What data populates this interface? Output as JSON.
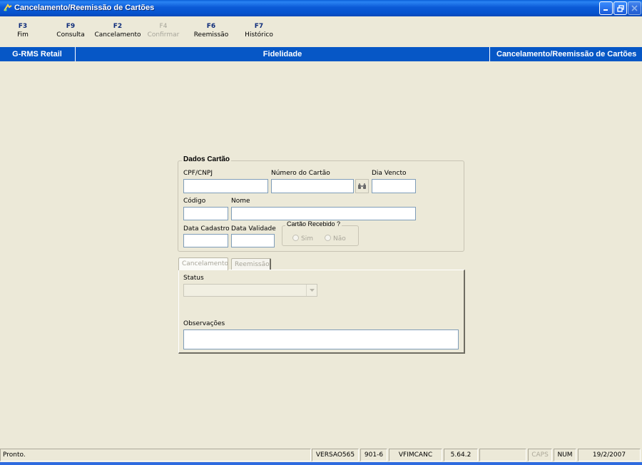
{
  "window": {
    "title": "Cancelamento/Reemissão de Cartões"
  },
  "fkeys": [
    {
      "key": "F3",
      "label": "Fim"
    },
    {
      "key": "F9",
      "label": "Consulta"
    },
    {
      "key": "F2",
      "label": "Cancelamento"
    },
    {
      "key": "F4",
      "label": "Confirmar"
    },
    {
      "key": "F6",
      "label": "Reemissão"
    },
    {
      "key": "F7",
      "label": "Histórico"
    }
  ],
  "band": {
    "left": "G-RMS Retail",
    "center": "Fidelidade",
    "right": "Cancelamento/Reemissão de Cartões"
  },
  "dados_cartao": {
    "title": "Dados Cartão",
    "cpf_label": "CPF/CNPJ",
    "cpf_value": "",
    "numero_label": "Número do Cartão",
    "numero_value": "",
    "dia_vencto_label": "Dia Vencto",
    "dia_vencto_value": "",
    "codigo_label": "Código",
    "codigo_value": "",
    "nome_label": "Nome",
    "nome_value": "",
    "data_cadastro_label": "Data Cadastro",
    "data_cadastro_value": "",
    "data_validade_label": "Data Validade",
    "data_validade_value": "",
    "recebido_title": "Cartão Recebido ?",
    "recebido_sim": "Sim",
    "recebido_nao": "Não"
  },
  "tabs": [
    {
      "label": "Cancelamento"
    },
    {
      "label": "Reemissão"
    }
  ],
  "cancelamento": {
    "status_label": "Status",
    "status_value": "",
    "obs_label": "Observações",
    "obs_value": ""
  },
  "statusbar": {
    "message": "Pronto.",
    "version": "VERSAO565",
    "code": "901-6",
    "program": "VFIMCANC",
    "build": "5.64.2",
    "blank": "",
    "caps": "CAPS",
    "num": "NUM",
    "date": "19/2/2007"
  },
  "colors": {
    "accent": "#0657c6",
    "window_bg": "#ece9d8"
  }
}
